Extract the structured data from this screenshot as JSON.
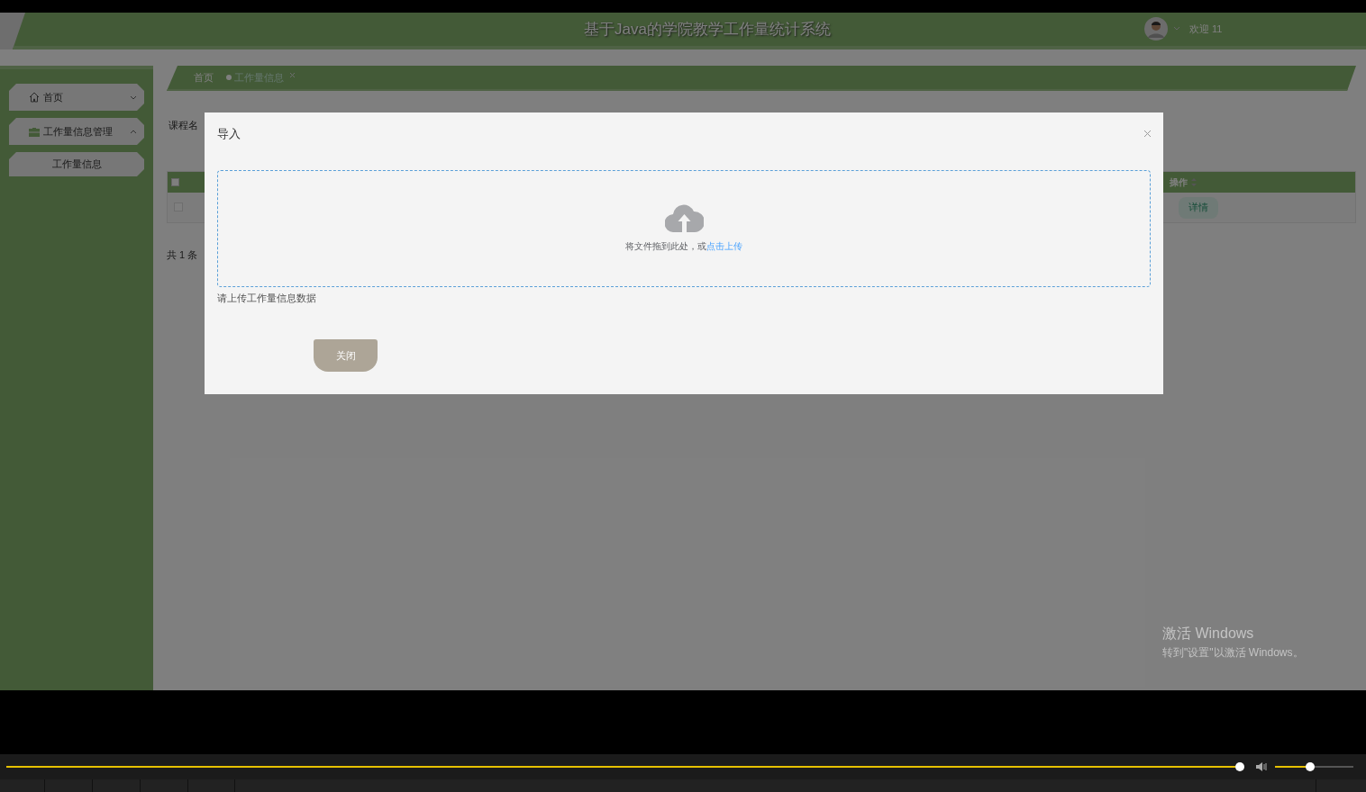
{
  "header": {
    "title": "基于Java的学院教学工作量统计系统",
    "welcome": "欢迎 11"
  },
  "sidebar": {
    "items": [
      {
        "label": "首页",
        "expanded": false
      },
      {
        "label": "工作量信息管理",
        "expanded": true,
        "children": [
          {
            "label": "工作量信息"
          }
        ]
      }
    ]
  },
  "tabs": [
    {
      "label": "首页",
      "selected": false,
      "closable": false
    },
    {
      "label": "工作量信息",
      "selected": true,
      "closable": true
    }
  ],
  "search": {
    "label": "课程名"
  },
  "table": {
    "select_all": {
      "checked": false
    },
    "columns": [
      {
        "label": "操作"
      }
    ],
    "rows": [
      {
        "checked": false,
        "action": "详情"
      }
    ]
  },
  "pagination": {
    "total": "共 1 条"
  },
  "dialog": {
    "title": "导入",
    "upload_hint": "将文件拖到此处，或",
    "upload_link": "点击上传",
    "tip": "请上传工作量信息数据",
    "close_button": "关闭"
  },
  "os_notice": {
    "title": "激活 Windows",
    "subtitle": "转到\"设置\"以激活 Windows。"
  },
  "player": {
    "progress": {
      "level": 0.999
    },
    "volume": {
      "level": 0.45
    }
  }
}
